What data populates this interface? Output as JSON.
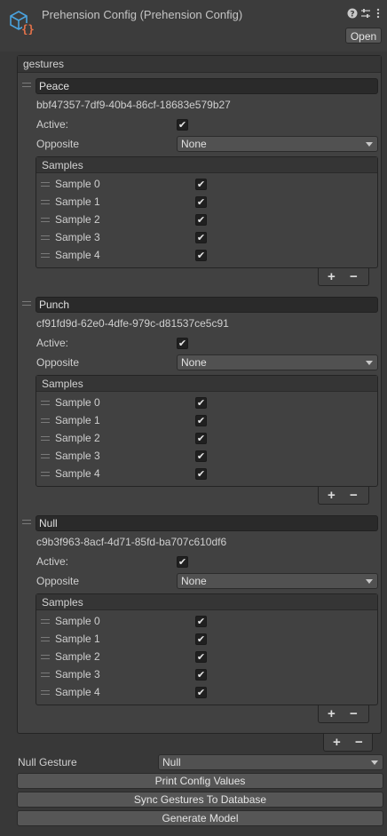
{
  "header": {
    "title": "Prehension Config (Prehension Config)",
    "open_label": "Open",
    "icons": [
      "asset-icon",
      "help-icon",
      "settings-sliders-icon",
      "kebab-menu-icon"
    ]
  },
  "list": {
    "label": "gestures",
    "items": [
      {
        "name": "Peace",
        "guid": "bbf47357-7df9-40b4-86cf-18683e579b27",
        "active_label": "Active:",
        "active": true,
        "opposite_label": "Opposite",
        "opposite_value": "None",
        "samples_label": "Samples",
        "samples": [
          {
            "label": "Sample 0",
            "checked": true
          },
          {
            "label": "Sample 1",
            "checked": true
          },
          {
            "label": "Sample 2",
            "checked": true
          },
          {
            "label": "Sample 3",
            "checked": true
          },
          {
            "label": "Sample 4",
            "checked": true
          }
        ]
      },
      {
        "name": "Punch",
        "guid": "cf91fd9d-62e0-4dfe-979c-d81537ce5c91",
        "active_label": "Active:",
        "active": true,
        "opposite_label": "Opposite",
        "opposite_value": "None",
        "samples_label": "Samples",
        "samples": [
          {
            "label": "Sample 0",
            "checked": true
          },
          {
            "label": "Sample 1",
            "checked": true
          },
          {
            "label": "Sample 2",
            "checked": true
          },
          {
            "label": "Sample 3",
            "checked": true
          },
          {
            "label": "Sample 4",
            "checked": true
          }
        ]
      },
      {
        "name": "Null",
        "guid": "c9b3f963-8acf-4d71-85fd-ba707c610df6",
        "active_label": "Active:",
        "active": true,
        "opposite_label": "Opposite",
        "opposite_value": "None",
        "samples_label": "Samples",
        "samples": [
          {
            "label": "Sample 0",
            "checked": true
          },
          {
            "label": "Sample 1",
            "checked": true
          },
          {
            "label": "Sample 2",
            "checked": true
          },
          {
            "label": "Sample 3",
            "checked": true
          },
          {
            "label": "Sample 4",
            "checked": true
          }
        ]
      }
    ],
    "add_label": "+",
    "remove_label": "−"
  },
  "null_gesture": {
    "label": "Null Gesture",
    "value": "Null"
  },
  "buttons": {
    "print_config": "Print Config Values",
    "sync_gestures": "Sync Gestures To Database",
    "generate_model": "Generate Model"
  },
  "colors": {
    "background": "#383838",
    "field": "#2a2a2a",
    "button": "#565656",
    "icon_blue": "#4aa3df",
    "icon_orange": "#e8734a"
  }
}
